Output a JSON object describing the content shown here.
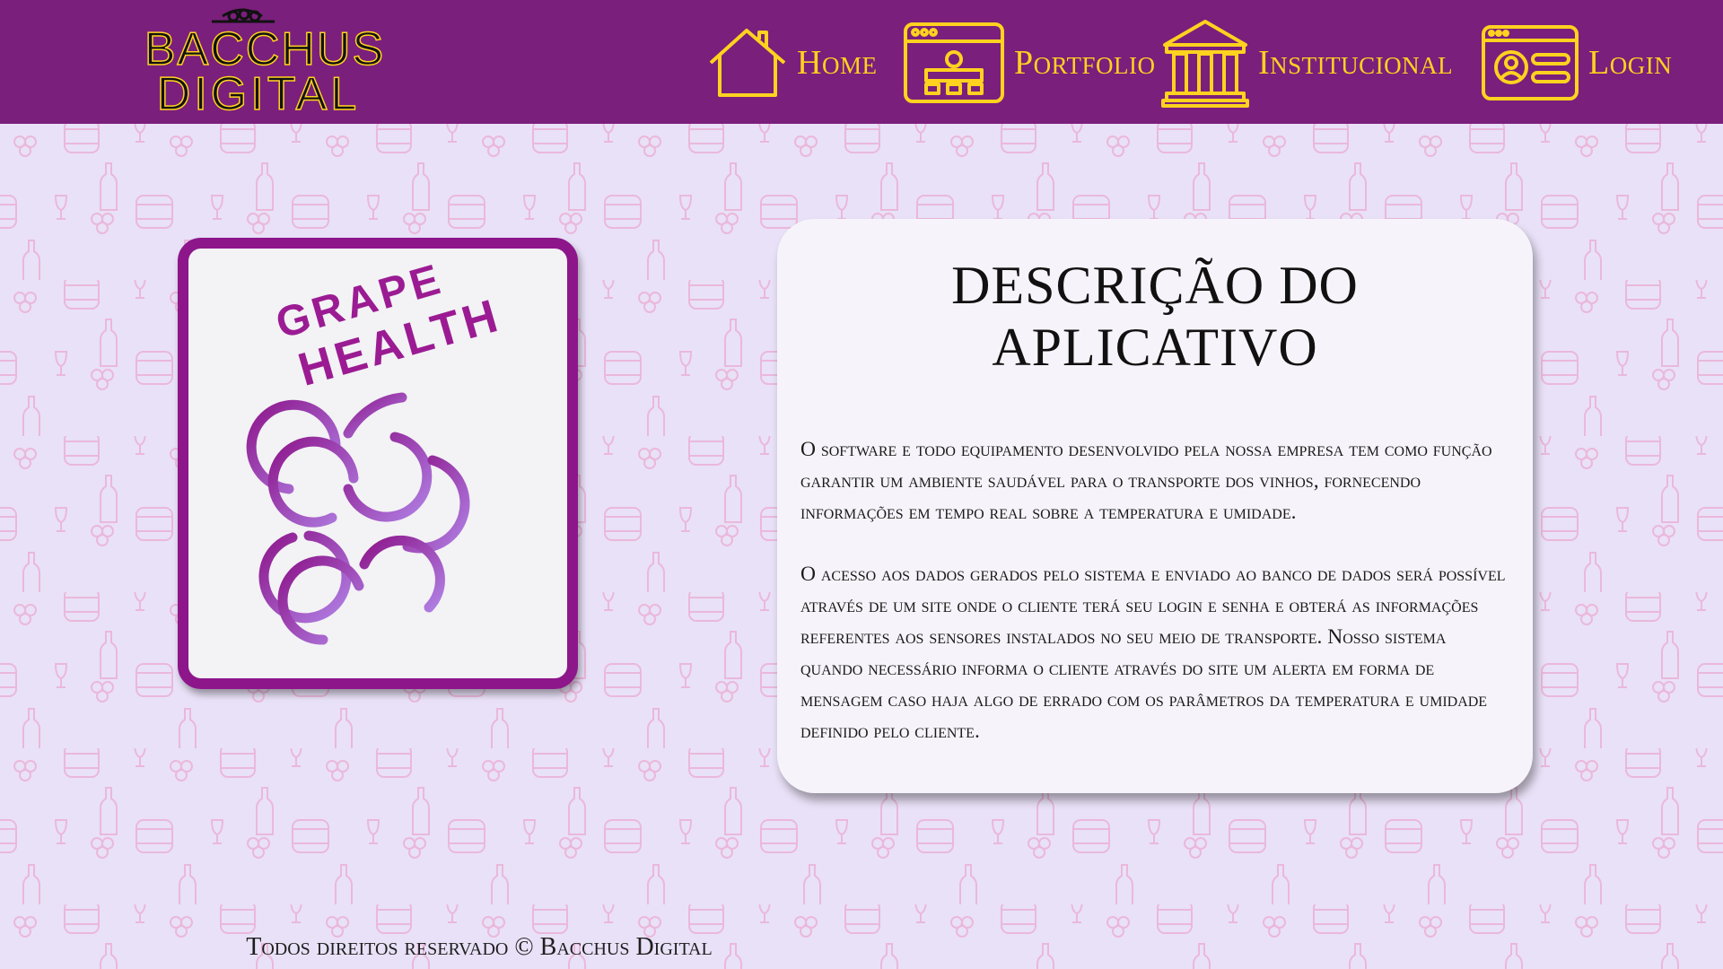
{
  "header": {
    "logo_line1": "BACCHUS",
    "logo_line2": "DIGITAL",
    "nav": [
      {
        "label": "Home",
        "icon": "home-icon"
      },
      {
        "label": "Portfolio",
        "icon": "portfolio-icon"
      },
      {
        "label": "Institucional",
        "icon": "institution-icon"
      },
      {
        "label": "Login",
        "icon": "login-icon"
      }
    ]
  },
  "product_logo": {
    "line1": "GRAPE",
    "line2": "HEALTH",
    "icon": "grape-icon"
  },
  "description": {
    "title": "DESCRIÇÃO DO APLICATIVO",
    "paragraphs": [
      "O software e todo equipamento desenvolvido pela nossa empresa tem como função garantir um ambiente saudável para o transporte dos vinhos, fornecendo informações em tempo real sobre a temperatura e umidade.",
      "O acesso aos dados gerados pelo sistema e enviado ao banco de dados será possível através de um site onde o cliente terá seu login e senha e obterá as informações referentes aos sensores instalados no seu meio de transporte. Nosso sistema quando necessário informa o cliente através do site um alerta em forma de mensagem caso haja algo de errado com os parâmetros da temperatura e umidade definido pelo cliente."
    ]
  },
  "footer": {
    "text": "Todos direitos reservado © Bacchus Digital"
  },
  "colors": {
    "header_bg": "#7a1f7c",
    "accent_gold": "#ffd21f",
    "page_bg": "#e9e1f7",
    "pattern": "#eab8dc",
    "grape_purple": "#8d168b",
    "grape_lavender": "#a46ad6"
  }
}
